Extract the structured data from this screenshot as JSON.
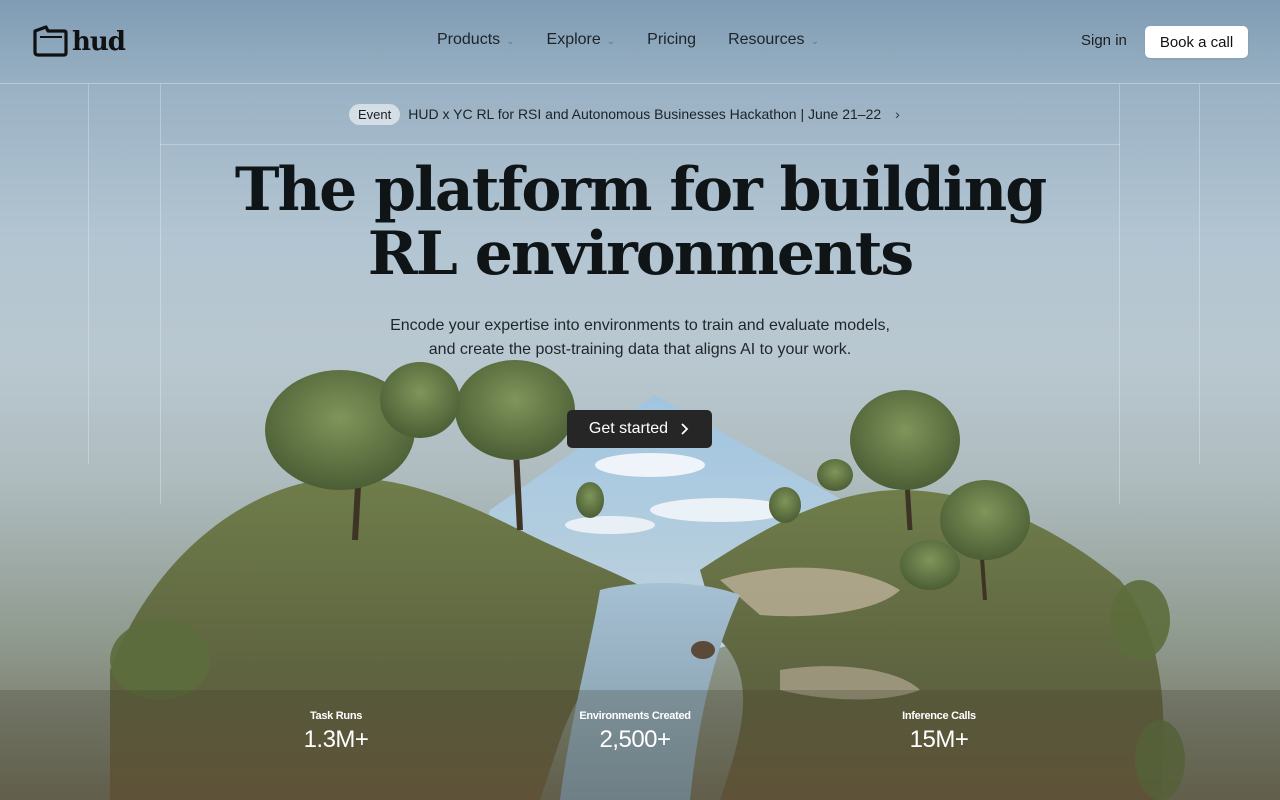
{
  "header": {
    "brand": "hud",
    "nav": [
      {
        "label": "Products",
        "has_dropdown": true
      },
      {
        "label": "Explore",
        "has_dropdown": true
      },
      {
        "label": "Pricing",
        "has_dropdown": false
      },
      {
        "label": "Resources",
        "has_dropdown": true
      }
    ],
    "sign_in": "Sign in",
    "book_call": "Book a call"
  },
  "announcement": {
    "badge": "Event",
    "text": "HUD x YC RL for RSI and Autonomous Businesses Hackathon | June 21–22",
    "arrow_icon": "chevron-right-icon"
  },
  "hero": {
    "title_line1": "The platform for building",
    "title_line2": "RL environments",
    "subtitle_line1": "Encode your expertise into environments to train and evaluate models,",
    "subtitle_line2": "and create the post-training data that aligns AI to your work.",
    "cta": "Get started"
  },
  "stats": [
    {
      "label": "Task Runs",
      "value": "1.3M+"
    },
    {
      "label": "Environments Created",
      "value": "2,500+"
    },
    {
      "label": "Inference Calls",
      "value": "15M+"
    }
  ],
  "colors": {
    "cta_bg": "#262626",
    "book_bg": "#ffffff",
    "text": "#0f1417"
  }
}
